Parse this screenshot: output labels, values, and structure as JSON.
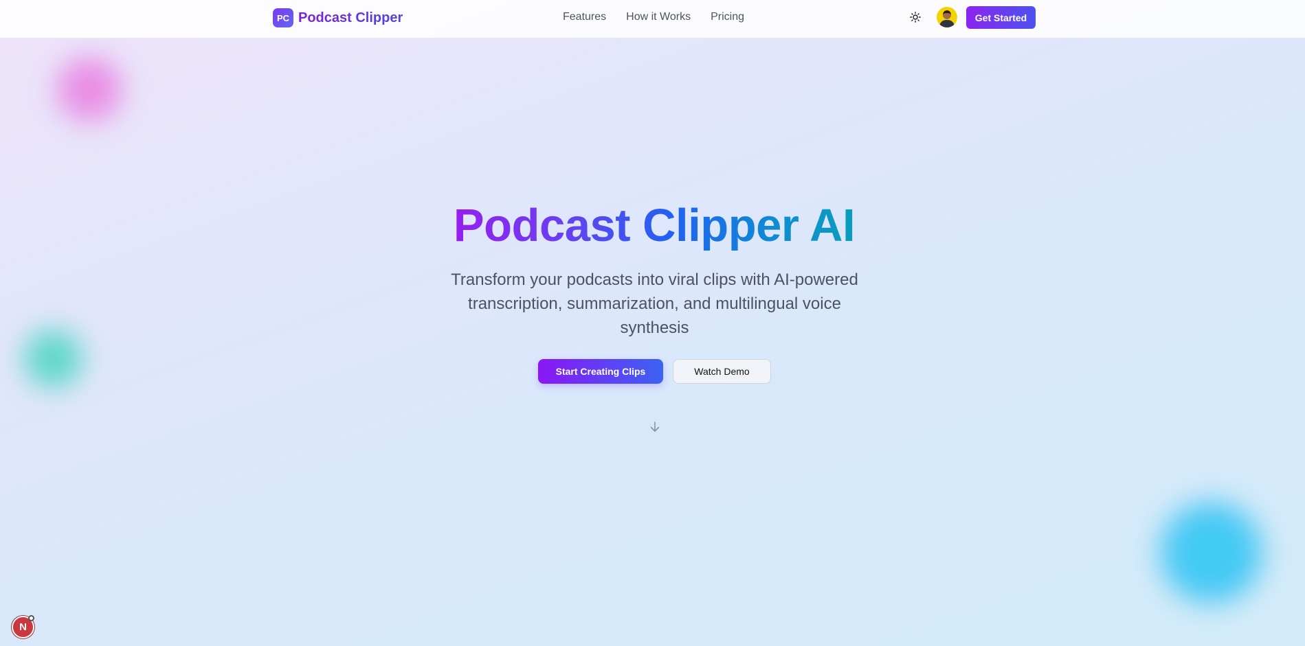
{
  "brand": {
    "badge": "PC",
    "name": "Podcast Clipper",
    "gradient": [
      "#7c3aed",
      "#4f46e5"
    ]
  },
  "nav": {
    "items": [
      {
        "label": "Features"
      },
      {
        "label": "How it Works"
      },
      {
        "label": "Pricing"
      }
    ]
  },
  "header": {
    "theme_icon": "sun-icon",
    "cta_label": "Get Started"
  },
  "hero": {
    "title": "Podcast Clipper AI",
    "subtitle": "Transform your podcasts into viral clips with AI-powered transcription, summarization, and multilingual voice synthesis",
    "primary_button": "Start Creating Clips",
    "secondary_button": "Watch Demo",
    "scroll_icon": "arrow-down-icon"
  },
  "dev_badge": {
    "label": "N"
  },
  "colors": {
    "accent": "#7c3aed",
    "accent_blue": "#3b63f2",
    "text": "#4b5262"
  }
}
